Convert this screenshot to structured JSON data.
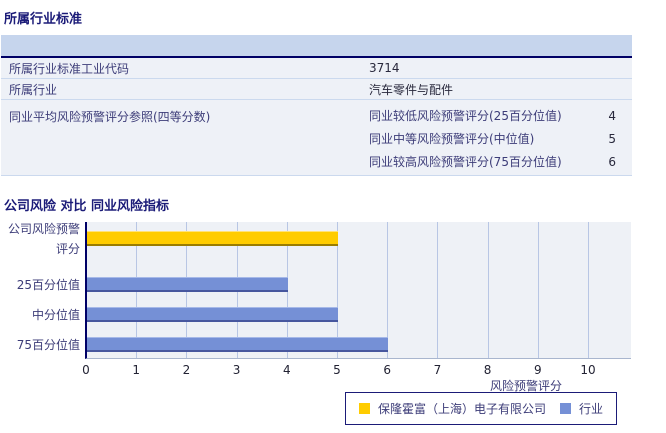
{
  "page": {
    "section1_title": "所属行业标准",
    "section2_title": "公司风险 对比 同业风险指标"
  },
  "table": {
    "rows": [
      {
        "label": "所属行业标准工业代码",
        "value": "3714"
      },
      {
        "label": "所属行业",
        "value": "汽车零件与配件"
      },
      {
        "label": "同业平均风险预警评分参照(四等分数)",
        "subrows": [
          {
            "label": "同业较低风险预警评分(25百分位值)",
            "value": "4"
          },
          {
            "label": "同业中等风险预警评分(中位值)",
            "value": "5"
          },
          {
            "label": "同业较高风险预警评分(75百分位值)",
            "value": "6"
          }
        ]
      }
    ]
  },
  "chart_data": {
    "type": "bar",
    "orientation": "horizontal",
    "title": "公司风险 对比 同业风险指标",
    "categories": [
      "公司风险预警评分",
      "25百分位值",
      "中分位值",
      "75百分位值"
    ],
    "series": [
      {
        "name": "保隆霍富（上海）电子有限公司",
        "color": "#FFCC00",
        "values": [
          5,
          null,
          null,
          null
        ]
      },
      {
        "name": "行业",
        "color": "#7590D6",
        "values": [
          null,
          4,
          5,
          6
        ]
      }
    ],
    "xlabel": "风险预警评分",
    "xlim": [
      0,
      10.85
    ],
    "xticks": [
      0,
      1,
      2,
      3,
      4,
      5,
      6,
      7,
      8,
      9,
      10
    ],
    "grid": true,
    "legend_position": "bottom-right",
    "plot_background": "#EEF1F6",
    "gridline_color": "#B8C6E4",
    "axis_color": "#000066"
  },
  "ui_colors": {
    "table_header_band": "#C6D5ED",
    "table_row_background": "#EEF1F7",
    "title_text": "#1B1B78",
    "label_text": "#3C3C78"
  }
}
